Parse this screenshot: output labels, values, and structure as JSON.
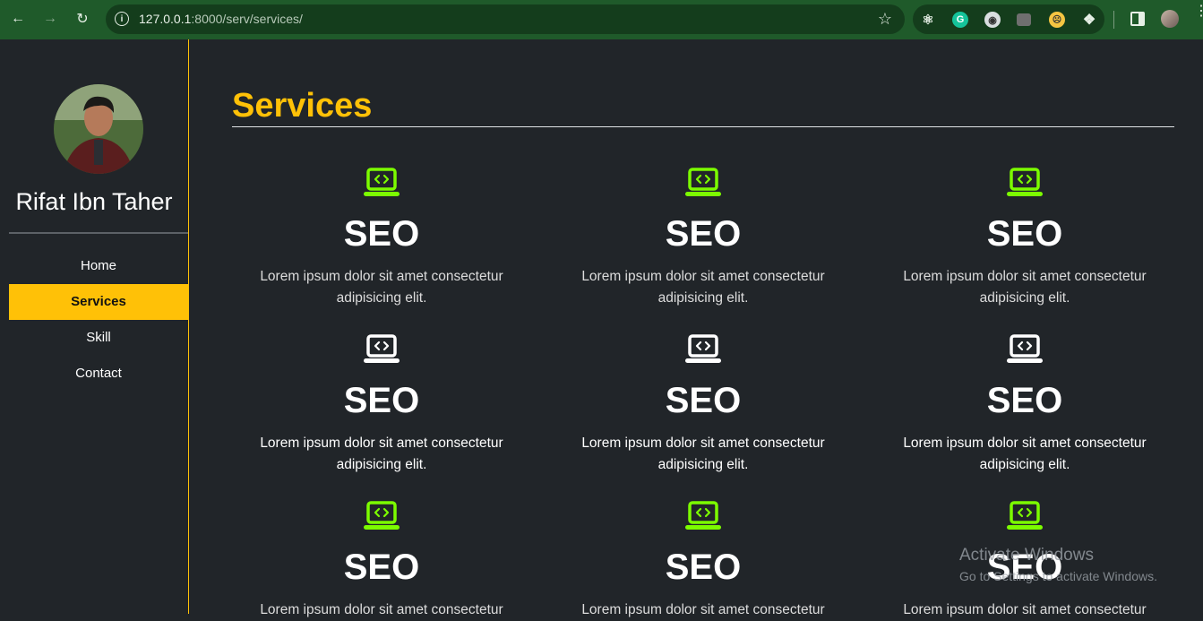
{
  "browser": {
    "url_host": "127.0.0.1",
    "url_path": ":8000/serv/services/",
    "colors": {
      "toolbar": "#1f5a2a",
      "omnibox": "#143d1c"
    }
  },
  "sidebar": {
    "owner_name": "Rifat Ibn Taher",
    "nav": [
      {
        "label": "Home",
        "active": false
      },
      {
        "label": "Services",
        "active": true
      },
      {
        "label": "Skill",
        "active": false
      },
      {
        "label": "Contact",
        "active": false
      }
    ]
  },
  "main": {
    "title": "Services",
    "cards": [
      {
        "title": "SEO",
        "text": "Lorem ipsum dolor sit amet consectetur adipisicing elit.",
        "icon_color": "#7cfc00"
      },
      {
        "title": "SEO",
        "text": "Lorem ipsum dolor sit amet consectetur adipisicing elit.",
        "icon_color": "#7cfc00"
      },
      {
        "title": "SEO",
        "text": "Lorem ipsum dolor sit amet consectetur adipisicing elit.",
        "icon_color": "#7cfc00"
      },
      {
        "title": "SEO",
        "text": "Lorem ipsum dolor sit amet consectetur adipisicing elit.",
        "icon_color": "#ffffff"
      },
      {
        "title": "SEO",
        "text": "Lorem ipsum dolor sit amet consectetur adipisicing elit.",
        "icon_color": "#ffffff"
      },
      {
        "title": "SEO",
        "text": "Lorem ipsum dolor sit amet consectetur adipisicing elit.",
        "icon_color": "#ffffff"
      },
      {
        "title": "SEO",
        "text": "Lorem ipsum dolor sit amet consectetur",
        "icon_color": "#7cfc00"
      },
      {
        "title": "SEO",
        "text": "Lorem ipsum dolor sit amet consectetur",
        "icon_color": "#7cfc00"
      },
      {
        "title": "SEO",
        "text": "Lorem ipsum dolor sit amet consectetur",
        "icon_color": "#7cfc00"
      }
    ]
  },
  "theme": {
    "accent": "#ffc107",
    "background": "#212529",
    "icon_green": "#7cfc00"
  },
  "watermark": {
    "title": "Activate Windows",
    "subtitle": "Go to Settings to activate Windows."
  }
}
